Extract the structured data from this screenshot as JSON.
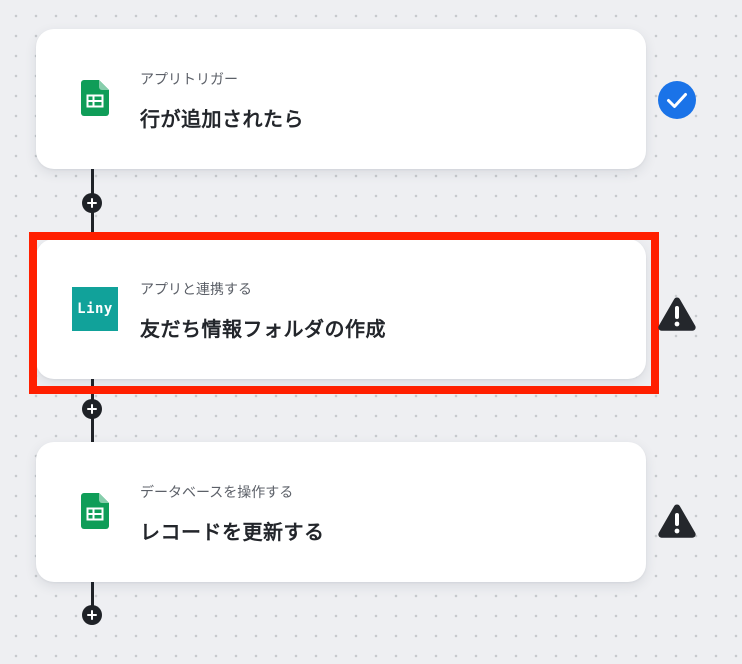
{
  "steps": [
    {
      "app_icon": "google-sheets-icon",
      "subtitle": "アプリトリガー",
      "title": "行が追加されたら",
      "status": "complete",
      "status_icon": "check-circle-icon"
    },
    {
      "app_icon": "liny-logo-icon",
      "app_logo_text": "Liny",
      "subtitle": "アプリと連携する",
      "title": "友だち情報フォルダの作成",
      "status": "warning",
      "status_icon": "warning-icon",
      "highlighted": true
    },
    {
      "app_icon": "google-sheets-icon",
      "subtitle": "データベースを操作する",
      "title": "レコードを更新する",
      "status": "warning",
      "status_icon": "warning-icon"
    }
  ],
  "colors": {
    "canvas_background": "#eeeff2",
    "grid_dot": "#c7cace",
    "card_background": "#ffffff",
    "connector": "#1f2227",
    "check_blue": "#1a73e8",
    "warning_dark": "#24272c",
    "highlight_red": "#ff1f00",
    "sheets_green": "#0f9d58",
    "liny_teal": "#11a29a"
  }
}
